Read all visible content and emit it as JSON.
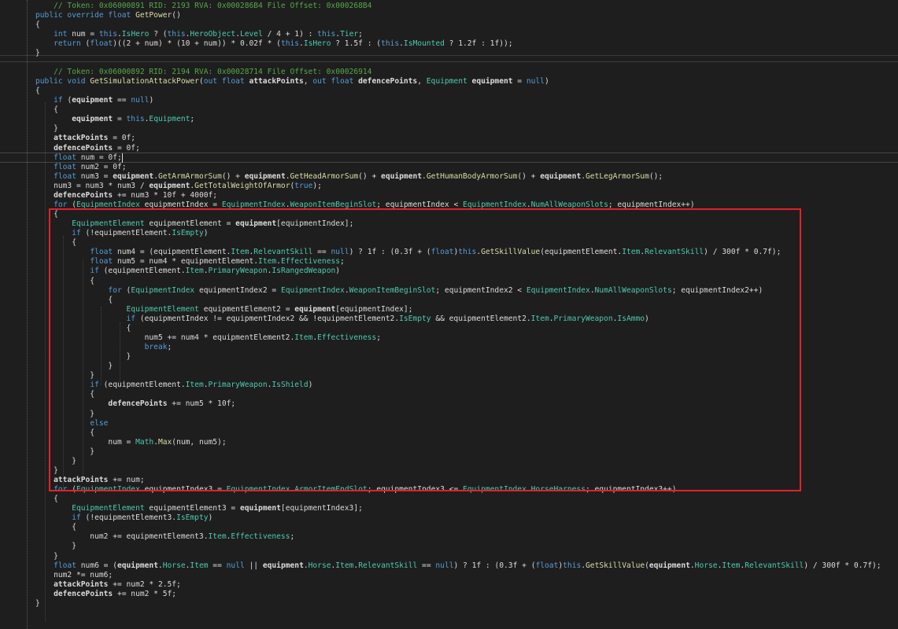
{
  "colors": {
    "background": "#1e1e1e",
    "plain": "#dcdcdc",
    "keyword": "#569cd6",
    "type": "#4ec9b0",
    "method": "#dcdcaa",
    "member": "#4ec9b0",
    "comment": "#57a64a",
    "param": "#dcdcdc",
    "highlight": "#e5202a"
  },
  "code_lines": [
    [
      [
        "c",
        "    // Token: 0x06000891 RID: 2193 RVA: 0x000286B4 File Offset: 0x000268B4"
      ]
    ],
    [
      [
        "k",
        "public override float "
      ],
      [
        "m",
        "GetPower"
      ],
      [
        "p",
        "()"
      ]
    ],
    [
      [
        "p",
        "{"
      ]
    ],
    [
      [
        "p",
        "    "
      ],
      [
        "k",
        "int"
      ],
      [
        "p",
        " num = "
      ],
      [
        "k",
        "this"
      ],
      [
        "p",
        "."
      ],
      [
        "t",
        "IsHero"
      ],
      [
        "p",
        " ? ("
      ],
      [
        "k",
        "this"
      ],
      [
        "p",
        "."
      ],
      [
        "t",
        "HeroObject"
      ],
      [
        "p",
        "."
      ],
      [
        "t",
        "Level"
      ],
      [
        "p",
        " / 4 + 1) : "
      ],
      [
        "k",
        "this"
      ],
      [
        "p",
        "."
      ],
      [
        "t",
        "Tier"
      ],
      [
        "p",
        ";"
      ]
    ],
    [
      [
        "p",
        "    "
      ],
      [
        "k",
        "return"
      ],
      [
        "p",
        " ("
      ],
      [
        "k",
        "float"
      ],
      [
        "p",
        ")((2 + num) * (10 + num)) * 0.02f * ("
      ],
      [
        "k",
        "this"
      ],
      [
        "p",
        "."
      ],
      [
        "t",
        "IsHero"
      ],
      [
        "p",
        " ? 1.5f : ("
      ],
      [
        "k",
        "this"
      ],
      [
        "p",
        "."
      ],
      [
        "t",
        "IsMounted"
      ],
      [
        "p",
        " ? 1.2f : 1f));"
      ]
    ],
    [
      [
        "p",
        "}"
      ]
    ],
    [
      [
        "p",
        ""
      ]
    ],
    [
      [
        "c",
        "    // Token: 0x06000892 RID: 2194 RVA: 0x00028714 File Offset: 0x00026914"
      ]
    ],
    [
      [
        "k",
        "public void "
      ],
      [
        "m",
        "GetSimulationAttackPower"
      ],
      [
        "p",
        "("
      ],
      [
        "k",
        "out float"
      ],
      [
        "b",
        " attackPoints"
      ],
      [
        "p",
        ", "
      ],
      [
        "k",
        "out float"
      ],
      [
        "b",
        " defencePoints"
      ],
      [
        "p",
        ", "
      ],
      [
        "t",
        "Equipment"
      ],
      [
        "b",
        " equipment"
      ],
      [
        "p",
        " = "
      ],
      [
        "k",
        "null"
      ],
      [
        "p",
        ")"
      ]
    ],
    [
      [
        "p",
        "{"
      ]
    ],
    [
      [
        "p",
        "    "
      ],
      [
        "k",
        "if"
      ],
      [
        "p",
        " ("
      ],
      [
        "b",
        "equipment"
      ],
      [
        "p",
        " == "
      ],
      [
        "k",
        "null"
      ],
      [
        "p",
        ")"
      ]
    ],
    [
      [
        "p",
        "    {"
      ]
    ],
    [
      [
        "p",
        "        "
      ],
      [
        "b",
        "equipment"
      ],
      [
        "p",
        " = "
      ],
      [
        "k",
        "this"
      ],
      [
        "p",
        "."
      ],
      [
        "t",
        "Equipment"
      ],
      [
        "p",
        ";"
      ]
    ],
    [
      [
        "p",
        "    }"
      ]
    ],
    [
      [
        "p",
        "    "
      ],
      [
        "b",
        "attackPoints"
      ],
      [
        "p",
        " = 0f;"
      ]
    ],
    [
      [
        "p",
        "    "
      ],
      [
        "b",
        "defencePoints"
      ],
      [
        "p",
        " = 0f;"
      ]
    ],
    [
      [
        "p",
        "    "
      ],
      [
        "k",
        "float"
      ],
      [
        "p",
        " num = 0f;"
      ]
    ],
    [
      [
        "p",
        "    "
      ],
      [
        "k",
        "float"
      ],
      [
        "p",
        " num2 = 0f;"
      ]
    ],
    [
      [
        "p",
        "    "
      ],
      [
        "k",
        "float"
      ],
      [
        "p",
        " num3 = "
      ],
      [
        "b",
        "equipment"
      ],
      [
        "p",
        "."
      ],
      [
        "m",
        "GetArmArmorSum"
      ],
      [
        "p",
        "() + "
      ],
      [
        "b",
        "equipment"
      ],
      [
        "p",
        "."
      ],
      [
        "m",
        "GetHeadArmorSum"
      ],
      [
        "p",
        "() + "
      ],
      [
        "b",
        "equipment"
      ],
      [
        "p",
        "."
      ],
      [
        "m",
        "GetHumanBodyArmorSum"
      ],
      [
        "p",
        "() + "
      ],
      [
        "b",
        "equipment"
      ],
      [
        "p",
        "."
      ],
      [
        "m",
        "GetLegArmorSum"
      ],
      [
        "p",
        "();"
      ]
    ],
    [
      [
        "p",
        "    num3 = num3 * num3 / "
      ],
      [
        "b",
        "equipment"
      ],
      [
        "p",
        "."
      ],
      [
        "m",
        "GetTotalWeightOfArmor"
      ],
      [
        "p",
        "("
      ],
      [
        "k",
        "true"
      ],
      [
        "p",
        ");"
      ]
    ],
    [
      [
        "p",
        "    "
      ],
      [
        "b",
        "defencePoints"
      ],
      [
        "p",
        " += num3 * 10f + 4000f;"
      ]
    ],
    [
      [
        "p",
        "    "
      ],
      [
        "k",
        "for"
      ],
      [
        "p",
        " ("
      ],
      [
        "t",
        "EquipmentIndex"
      ],
      [
        "p",
        " equipmentIndex = "
      ],
      [
        "t",
        "EquipmentIndex"
      ],
      [
        "p",
        "."
      ],
      [
        "u",
        "WeaponItemBeginSlot"
      ],
      [
        "p",
        "; equipmentIndex < "
      ],
      [
        "t",
        "EquipmentIndex"
      ],
      [
        "p",
        "."
      ],
      [
        "u",
        "NumAllWeaponSlots"
      ],
      [
        "p",
        "; equipmentIndex++)"
      ]
    ],
    [
      [
        "p",
        "    {"
      ]
    ],
    [
      [
        "p",
        "        "
      ],
      [
        "t",
        "EquipmentElement"
      ],
      [
        "p",
        " equipmentElement = "
      ],
      [
        "b",
        "equipment"
      ],
      [
        "p",
        "[equipmentIndex];"
      ]
    ],
    [
      [
        "p",
        "        "
      ],
      [
        "k",
        "if"
      ],
      [
        "p",
        " (!equipmentElement."
      ],
      [
        "t",
        "IsEmpty"
      ],
      [
        "p",
        ")"
      ]
    ],
    [
      [
        "p",
        "        {"
      ]
    ],
    [
      [
        "p",
        "            "
      ],
      [
        "k",
        "float"
      ],
      [
        "p",
        " num4 = (equipmentElement."
      ],
      [
        "t",
        "Item"
      ],
      [
        "p",
        "."
      ],
      [
        "t",
        "RelevantSkill"
      ],
      [
        "p",
        " == "
      ],
      [
        "k",
        "null"
      ],
      [
        "p",
        ") ? 1f : (0.3f + ("
      ],
      [
        "k",
        "float"
      ],
      [
        "p",
        ")"
      ],
      [
        "k",
        "this"
      ],
      [
        "p",
        "."
      ],
      [
        "m",
        "GetSkillValue"
      ],
      [
        "p",
        "(equipmentElement."
      ],
      [
        "t",
        "Item"
      ],
      [
        "p",
        "."
      ],
      [
        "t",
        "RelevantSkill"
      ],
      [
        "p",
        ") / 300f * 0.7f);"
      ]
    ],
    [
      [
        "p",
        "            "
      ],
      [
        "k",
        "float"
      ],
      [
        "p",
        " num5 = num4 * equipmentElement."
      ],
      [
        "t",
        "Item"
      ],
      [
        "p",
        "."
      ],
      [
        "t",
        "Effectiveness"
      ],
      [
        "p",
        ";"
      ]
    ],
    [
      [
        "p",
        "            "
      ],
      [
        "k",
        "if"
      ],
      [
        "p",
        " (equipmentElement."
      ],
      [
        "t",
        "Item"
      ],
      [
        "p",
        "."
      ],
      [
        "t",
        "PrimaryWeapon"
      ],
      [
        "p",
        "."
      ],
      [
        "t",
        "IsRangedWeapon"
      ],
      [
        "p",
        ")"
      ]
    ],
    [
      [
        "p",
        "            {"
      ]
    ],
    [
      [
        "p",
        "                "
      ],
      [
        "k",
        "for"
      ],
      [
        "p",
        " ("
      ],
      [
        "t",
        "EquipmentIndex"
      ],
      [
        "p",
        " equipmentIndex2 = "
      ],
      [
        "t",
        "EquipmentIndex"
      ],
      [
        "p",
        "."
      ],
      [
        "u",
        "WeaponItemBeginSlot"
      ],
      [
        "p",
        "; equipmentIndex2 < "
      ],
      [
        "t",
        "EquipmentIndex"
      ],
      [
        "p",
        "."
      ],
      [
        "u",
        "NumAllWeaponSlots"
      ],
      [
        "p",
        "; equipmentIndex2++)"
      ]
    ],
    [
      [
        "p",
        "                {"
      ]
    ],
    [
      [
        "p",
        "                    "
      ],
      [
        "t",
        "EquipmentElement"
      ],
      [
        "p",
        " equipmentElement2 = "
      ],
      [
        "b",
        "equipment"
      ],
      [
        "p",
        "[equipmentIndex];"
      ]
    ],
    [
      [
        "p",
        "                    "
      ],
      [
        "k",
        "if"
      ],
      [
        "p",
        " (equipmentIndex != equipmentIndex2 && !equipmentElement2."
      ],
      [
        "t",
        "IsEmpty"
      ],
      [
        "p",
        " && equipmentElement2."
      ],
      [
        "t",
        "Item"
      ],
      [
        "p",
        "."
      ],
      [
        "t",
        "PrimaryWeapon"
      ],
      [
        "p",
        "."
      ],
      [
        "t",
        "IsAmmo"
      ],
      [
        "p",
        ")"
      ]
    ],
    [
      [
        "p",
        "                    {"
      ]
    ],
    [
      [
        "p",
        "                        num5 += num4 * equipmentElement2."
      ],
      [
        "t",
        "Item"
      ],
      [
        "p",
        "."
      ],
      [
        "t",
        "Effectiveness"
      ],
      [
        "p",
        ";"
      ]
    ],
    [
      [
        "p",
        "                        "
      ],
      [
        "k",
        "break"
      ],
      [
        "p",
        ";"
      ]
    ],
    [
      [
        "p",
        "                    }"
      ]
    ],
    [
      [
        "p",
        "                }"
      ]
    ],
    [
      [
        "p",
        "            }"
      ]
    ],
    [
      [
        "p",
        "            "
      ],
      [
        "k",
        "if"
      ],
      [
        "p",
        " (equipmentElement."
      ],
      [
        "t",
        "Item"
      ],
      [
        "p",
        "."
      ],
      [
        "t",
        "PrimaryWeapon"
      ],
      [
        "p",
        "."
      ],
      [
        "t",
        "IsShield"
      ],
      [
        "p",
        ")"
      ]
    ],
    [
      [
        "p",
        "            {"
      ]
    ],
    [
      [
        "p",
        "                "
      ],
      [
        "b",
        "defencePoints"
      ],
      [
        "p",
        " += num5 * 10f;"
      ]
    ],
    [
      [
        "p",
        "            }"
      ]
    ],
    [
      [
        "p",
        "            "
      ],
      [
        "k",
        "else"
      ]
    ],
    [
      [
        "p",
        "            {"
      ]
    ],
    [
      [
        "p",
        "                num = "
      ],
      [
        "t",
        "Math"
      ],
      [
        "p",
        "."
      ],
      [
        "m",
        "Max"
      ],
      [
        "p",
        "(num, num5);"
      ]
    ],
    [
      [
        "p",
        "            }"
      ]
    ],
    [
      [
        "p",
        "        }"
      ]
    ],
    [
      [
        "p",
        "    }"
      ]
    ],
    [
      [
        "p",
        "    "
      ],
      [
        "b",
        "attackPoints"
      ],
      [
        "p",
        " += num;"
      ]
    ],
    [
      [
        "p",
        "    "
      ],
      [
        "k",
        "for"
      ],
      [
        "p",
        " ("
      ],
      [
        "t",
        "EquipmentIndex"
      ],
      [
        "p",
        " equipmentIndex3 = "
      ],
      [
        "t",
        "EquipmentIndex"
      ],
      [
        "p",
        "."
      ],
      [
        "u",
        "ArmorItemEndSlot"
      ],
      [
        "p",
        "; equipmentIndex3 <= "
      ],
      [
        "t",
        "EquipmentIndex"
      ],
      [
        "p",
        "."
      ],
      [
        "u",
        "HorseHarness"
      ],
      [
        "p",
        "; equipmentIndex3++)"
      ]
    ],
    [
      [
        "p",
        "    {"
      ]
    ],
    [
      [
        "p",
        "        "
      ],
      [
        "t",
        "EquipmentElement"
      ],
      [
        "p",
        " equipmentElement3 = "
      ],
      [
        "b",
        "equipment"
      ],
      [
        "p",
        "[equipmentIndex3];"
      ]
    ],
    [
      [
        "p",
        "        "
      ],
      [
        "k",
        "if"
      ],
      [
        "p",
        " (!equipmentElement3."
      ],
      [
        "t",
        "IsEmpty"
      ],
      [
        "p",
        ")"
      ]
    ],
    [
      [
        "p",
        "        {"
      ]
    ],
    [
      [
        "p",
        "            num2 += equipmentElement3."
      ],
      [
        "t",
        "Item"
      ],
      [
        "p",
        "."
      ],
      [
        "t",
        "Effectiveness"
      ],
      [
        "p",
        ";"
      ]
    ],
    [
      [
        "p",
        "        }"
      ]
    ],
    [
      [
        "p",
        "    }"
      ]
    ],
    [
      [
        "p",
        "    "
      ],
      [
        "k",
        "float"
      ],
      [
        "p",
        " num6 = ("
      ],
      [
        "b",
        "equipment"
      ],
      [
        "p",
        "."
      ],
      [
        "t",
        "Horse"
      ],
      [
        "p",
        "."
      ],
      [
        "t",
        "Item"
      ],
      [
        "p",
        " == "
      ],
      [
        "k",
        "null"
      ],
      [
        "p",
        " || "
      ],
      [
        "b",
        "equipment"
      ],
      [
        "p",
        "."
      ],
      [
        "t",
        "Horse"
      ],
      [
        "p",
        "."
      ],
      [
        "t",
        "Item"
      ],
      [
        "p",
        "."
      ],
      [
        "t",
        "RelevantSkill"
      ],
      [
        "p",
        " == "
      ],
      [
        "k",
        "null"
      ],
      [
        "p",
        ") ? 1f : (0.3f + ("
      ],
      [
        "k",
        "float"
      ],
      [
        "p",
        ")"
      ],
      [
        "k",
        "this"
      ],
      [
        "p",
        "."
      ],
      [
        "m",
        "GetSkillValue"
      ],
      [
        "p",
        "("
      ],
      [
        "b",
        "equipment"
      ],
      [
        "p",
        "."
      ],
      [
        "t",
        "Horse"
      ],
      [
        "p",
        "."
      ],
      [
        "t",
        "Item"
      ],
      [
        "p",
        "."
      ],
      [
        "t",
        "RelevantSkill"
      ],
      [
        "p",
        ") / 300f * 0.7f);"
      ]
    ],
    [
      [
        "p",
        "    num2 *= num6;"
      ]
    ],
    [
      [
        "p",
        "    "
      ],
      [
        "b",
        "attackPoints"
      ],
      [
        "p",
        " += num2 * 2.5f;"
      ]
    ],
    [
      [
        "p",
        "    "
      ],
      [
        "b",
        "defencePoints"
      ],
      [
        "p",
        " += num2 * 5f;"
      ]
    ],
    [
      [
        "p",
        "}"
      ]
    ]
  ]
}
